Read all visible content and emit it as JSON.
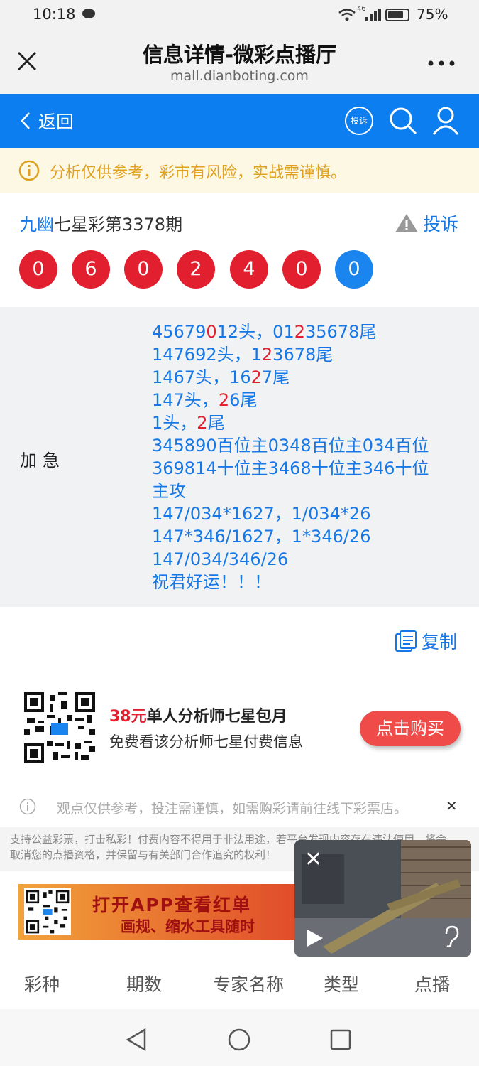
{
  "status": {
    "time": "10:18",
    "network": "46",
    "battery": "75%"
  },
  "titlebar": {
    "title": "信息详情-微彩点播厅",
    "url": "mall.dianboting.com"
  },
  "nav": {
    "back_label": "返回",
    "complain_icon_text": "投诉"
  },
  "notice": {
    "text": "分析仅供参考，彩市有风险，实战需谨慎。"
  },
  "issue": {
    "brand": "九幽",
    "title": "七星彩第3378期",
    "report_label": "投诉"
  },
  "balls": [
    {
      "value": "0",
      "color": "#e21f2f"
    },
    {
      "value": "6",
      "color": "#e21f2f"
    },
    {
      "value": "0",
      "color": "#e21f2f"
    },
    {
      "value": "2",
      "color": "#e21f2f"
    },
    {
      "value": "4",
      "color": "#e21f2f"
    },
    {
      "value": "0",
      "color": "#e21f2f"
    },
    {
      "value": "0",
      "color": "#1a85ee"
    }
  ],
  "content": {
    "label": "加急",
    "lines": [
      [
        {
          "t": "45679"
        },
        {
          "t": "0",
          "r": true
        },
        {
          "t": "12头，01"
        },
        {
          "t": "2",
          "r": true
        },
        {
          "t": "35678尾"
        }
      ],
      [
        {
          "t": "147692头，1"
        },
        {
          "t": "2",
          "r": true
        },
        {
          "t": "3678尾"
        }
      ],
      [
        {
          "t": "1467头，16"
        },
        {
          "t": "2",
          "r": true
        },
        {
          "t": "7尾"
        }
      ],
      [
        {
          "t": "147头，"
        },
        {
          "t": "2",
          "r": true
        },
        {
          "t": "6尾"
        }
      ],
      [
        {
          "t": "1头，"
        },
        {
          "t": "2",
          "r": true
        },
        {
          "t": "尾"
        }
      ],
      [
        {
          "t": "345890百位主0348百位主034百位"
        }
      ],
      [
        {
          "t": "369814十位主3468十位主346十位"
        }
      ],
      [
        {
          "t": "主攻"
        }
      ],
      [
        {
          "t": "147/034*1627，1/034*26"
        }
      ],
      [
        {
          "t": "147*346/1627，1*346/26"
        }
      ],
      [
        {
          "t": "147/034/346/26"
        }
      ],
      [
        {
          "t": "祝君好运！！！"
        }
      ]
    ]
  },
  "copy_label": "复制",
  "promo": {
    "price": "38元",
    "title": "单人分析师七星包月",
    "subtitle": "免费看该分析师七星付费信息",
    "buy_label": "点击购买"
  },
  "disclaimer": "观点仅供参考，投注需谨慎，如需购彩请前往线下彩票店。",
  "legal": [
    "支持公益彩票，打击私彩！付费内容不得用于非法用途，若平台发现内容存在违法使用，将会",
    "取消您的点播资格，并保留与有关部门合作追究的权利！"
  ],
  "banner": {
    "line1": "打开APP查看红单",
    "line2": "画规、缩水工具随时"
  },
  "tabs": [
    "彩种",
    "期数",
    "专家名称",
    "类型",
    "点播"
  ]
}
